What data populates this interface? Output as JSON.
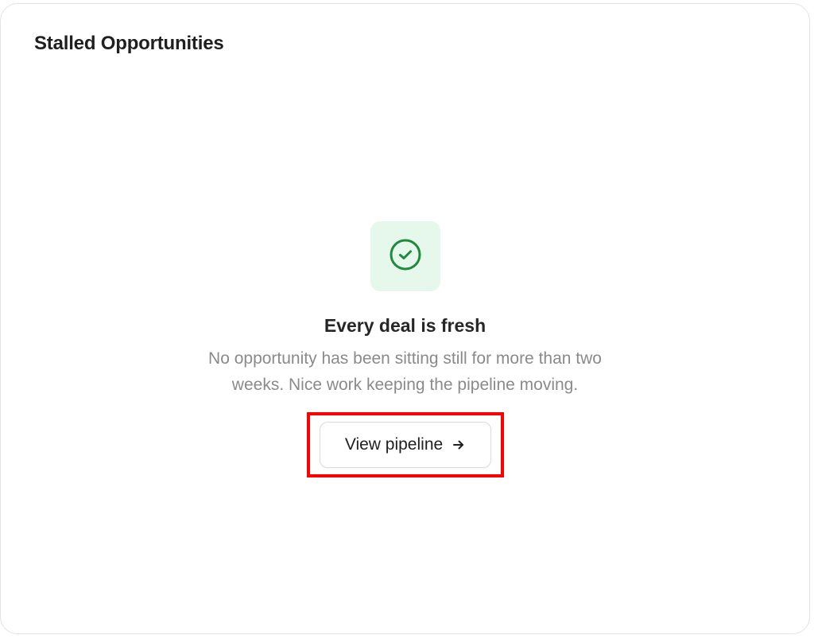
{
  "card": {
    "title": "Stalled Opportunities"
  },
  "empty_state": {
    "icon": "check-circle-icon",
    "icon_color": "#1e8a3c",
    "icon_bg": "#e6f7ec",
    "heading": "Every deal is fresh",
    "body": "No opportunity has been sitting still for more than two weeks. Nice work keeping the pipeline moving.",
    "button_label": "View pipeline",
    "button_icon": "arrow-right-icon",
    "highlight_color": "#ff0000"
  }
}
